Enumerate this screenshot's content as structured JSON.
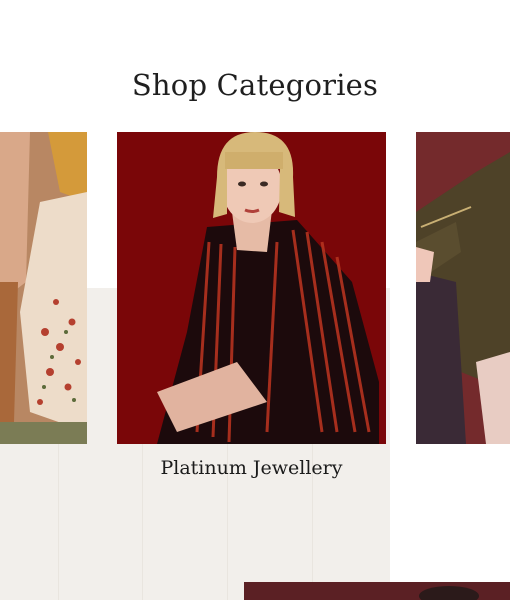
{
  "section": {
    "title": "Shop Categories"
  },
  "cards": [
    {
      "label": ""
    },
    {
      "label": "Platinum Jewellery"
    },
    {
      "label": ""
    }
  ],
  "colors": {
    "background": "#ffffff",
    "panel": "#f2efeb",
    "center_backdrop": "#7a0608",
    "right_backdrop": "#742a2c",
    "bottom_strip": "#5b2024"
  }
}
